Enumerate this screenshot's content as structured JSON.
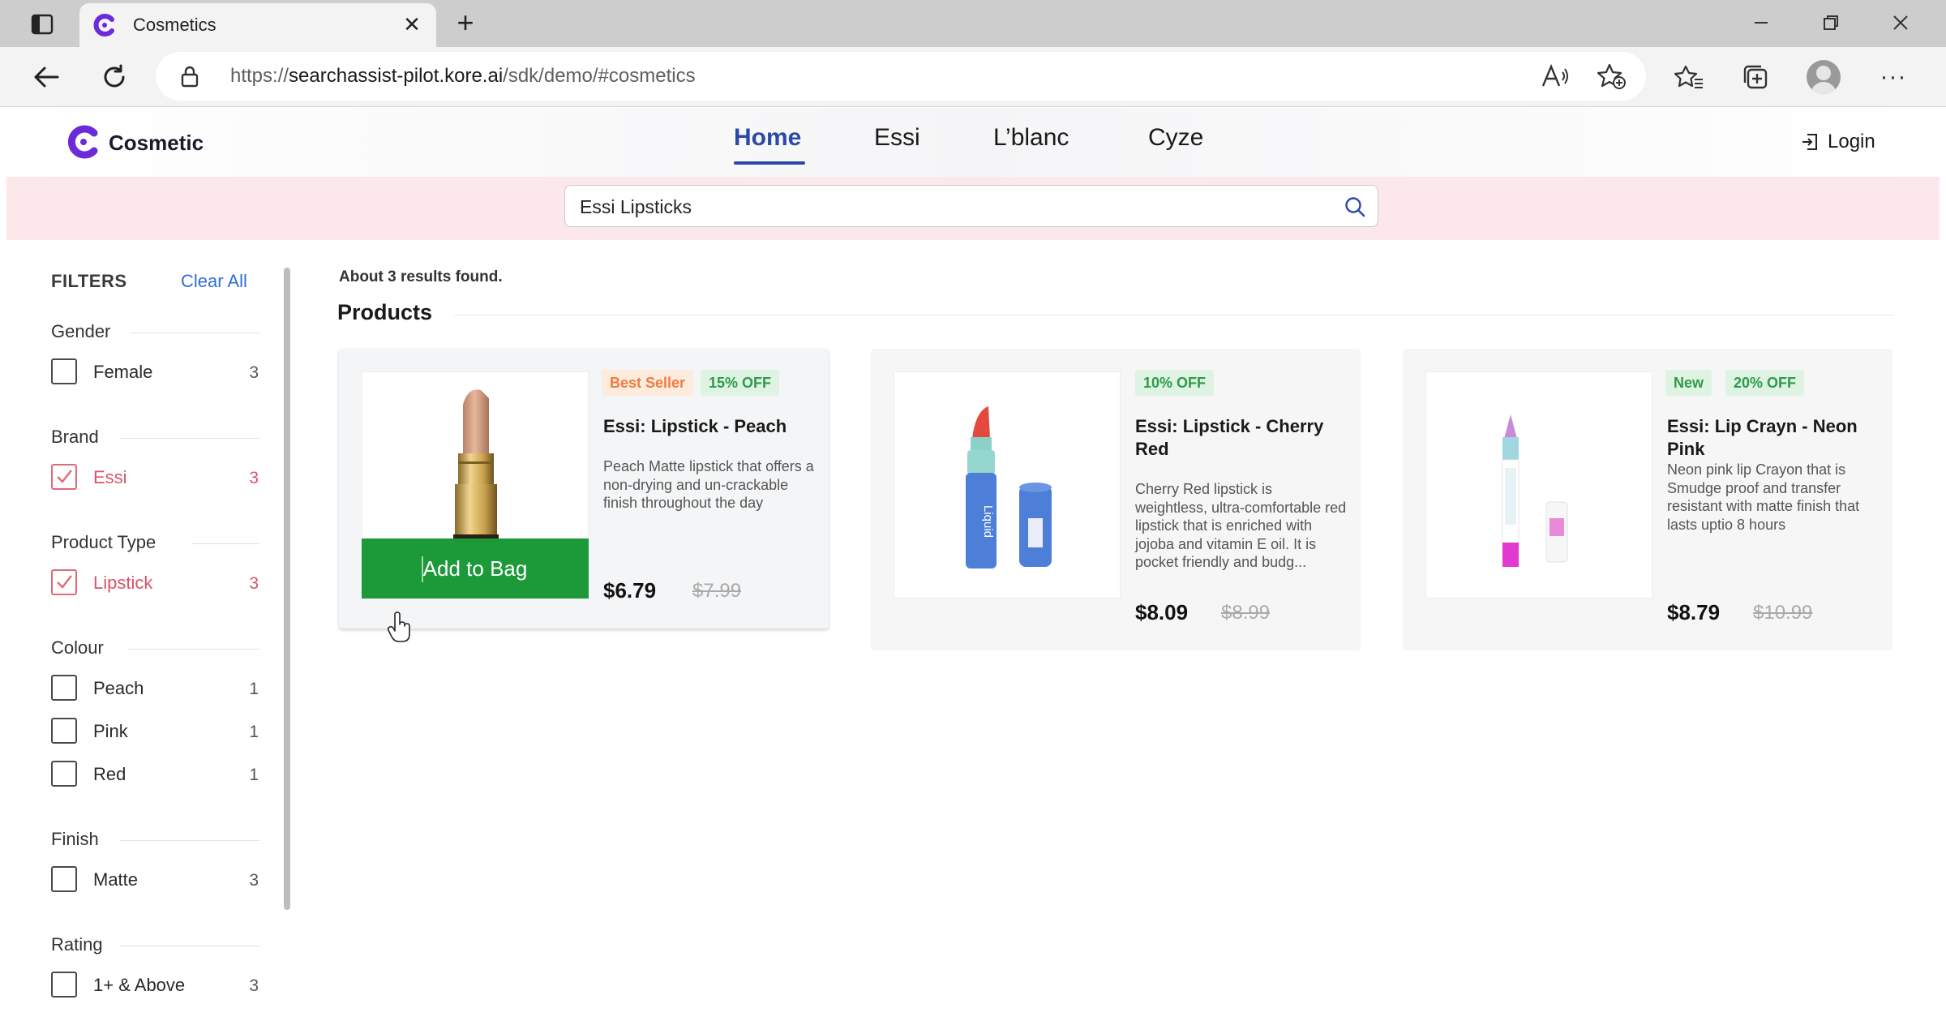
{
  "browser": {
    "tab_title": "Cosmetics",
    "url_scheme": "https://",
    "url_host": "searchassist-pilot.kore.ai",
    "url_path": "/sdk/demo/#cosmetics"
  },
  "site": {
    "logo_text": "Cosmetic",
    "menu": [
      "Home",
      "Essi",
      "L’blanc",
      "Cyze"
    ],
    "active_menu": "Home",
    "login_label": "Login",
    "search_value": "Essi Lipsticks",
    "brand_color": "#6b2bd9",
    "accent_color": "#2b4aa8"
  },
  "filters": {
    "title": "FILTERS",
    "clear_all": "Clear All",
    "groups": [
      {
        "name": "Gender",
        "options": [
          {
            "label": "Female",
            "count": "3",
            "checked": false
          }
        ]
      },
      {
        "name": "Brand",
        "options": [
          {
            "label": "Essi",
            "count": "3",
            "checked": true
          }
        ]
      },
      {
        "name": "Product Type",
        "options": [
          {
            "label": "Lipstick",
            "count": "3",
            "checked": true
          }
        ]
      },
      {
        "name": "Colour",
        "options": [
          {
            "label": "Peach",
            "count": "1",
            "checked": false
          },
          {
            "label": "Pink",
            "count": "1",
            "checked": false
          },
          {
            "label": "Red",
            "count": "1",
            "checked": false
          }
        ]
      },
      {
        "name": "Finish",
        "options": [
          {
            "label": "Matte",
            "count": "3",
            "checked": false
          }
        ]
      },
      {
        "name": "Rating",
        "options": [
          {
            "label": "1+ & Above",
            "count": "3",
            "checked": false
          }
        ]
      }
    ]
  },
  "results": {
    "count_text": "About 3 results found.",
    "section_title": "Products",
    "products": [
      {
        "badges": [
          "Best Seller",
          "15% OFF"
        ],
        "title": "Essi: Lipstick - Peach",
        "description": "Peach Matte lipstick that offers a non-drying and un-crackable finish throughout the day",
        "price": "$6.79",
        "old_price": "$7.99",
        "image_icon": "peach-lipstick-icon",
        "add_to_bag": "Add to Bag"
      },
      {
        "badges": [
          "10% OFF"
        ],
        "title": "Essi: Lipstick - Cherry Red",
        "description": "Cherry Red lipstick is weightless, ultra-comfortable red lipstick that is enriched with jojoba and vitamin E oil. It is pocket friendly and budg...",
        "price": "$8.09",
        "old_price": "$8.99",
        "image_icon": "liquid-lipstick-icon",
        "image_text": "Liquid"
      },
      {
        "badges": [
          "New",
          "20% OFF"
        ],
        "title": "Essi: Lip Crayn - Neon Pink",
        "description": "Neon pink lip Crayon that is Smudge proof and transfer resistant with matte finish that lasts uptio 8 hours",
        "price": "$8.79",
        "old_price": "$10.99",
        "image_icon": "lip-crayon-icon"
      }
    ]
  }
}
